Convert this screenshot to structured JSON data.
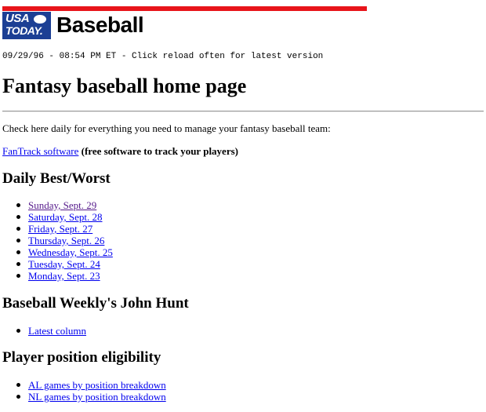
{
  "header": {
    "logo_line1": "USA",
    "logo_line2": "TODAY.",
    "section_title": "Baseball",
    "timestamp": "09/29/96 - 08:54 PM ET - Click reload often for latest version",
    "colors": {
      "red_bar": "#e8141a",
      "logo_bg": "#1c3f94",
      "link": "#0000ee",
      "visited_link": "#551a8b"
    }
  },
  "main": {
    "title": "Fantasy baseball home page",
    "intro": "Check here daily for everything you need to manage your fantasy baseball team:",
    "fantrack_link": "FanTrack software",
    "fantrack_note": "(free software to track your players)",
    "sections": [
      {
        "heading": "Daily Best/Worst",
        "links": [
          "Sunday, Sept. 29",
          "Saturday, Sept. 28",
          "Friday, Sept. 27",
          "Thursday, Sept. 26",
          "Wednesday, Sept. 25",
          "Tuesday, Sept. 24",
          "Monday, Sept. 23"
        ]
      },
      {
        "heading": "Baseball Weekly's John Hunt",
        "links": [
          "Latest column"
        ]
      },
      {
        "heading": "Player position eligibility",
        "links": [
          "AL games by position breakdown",
          "NL games by position breakdown"
        ]
      }
    ]
  }
}
